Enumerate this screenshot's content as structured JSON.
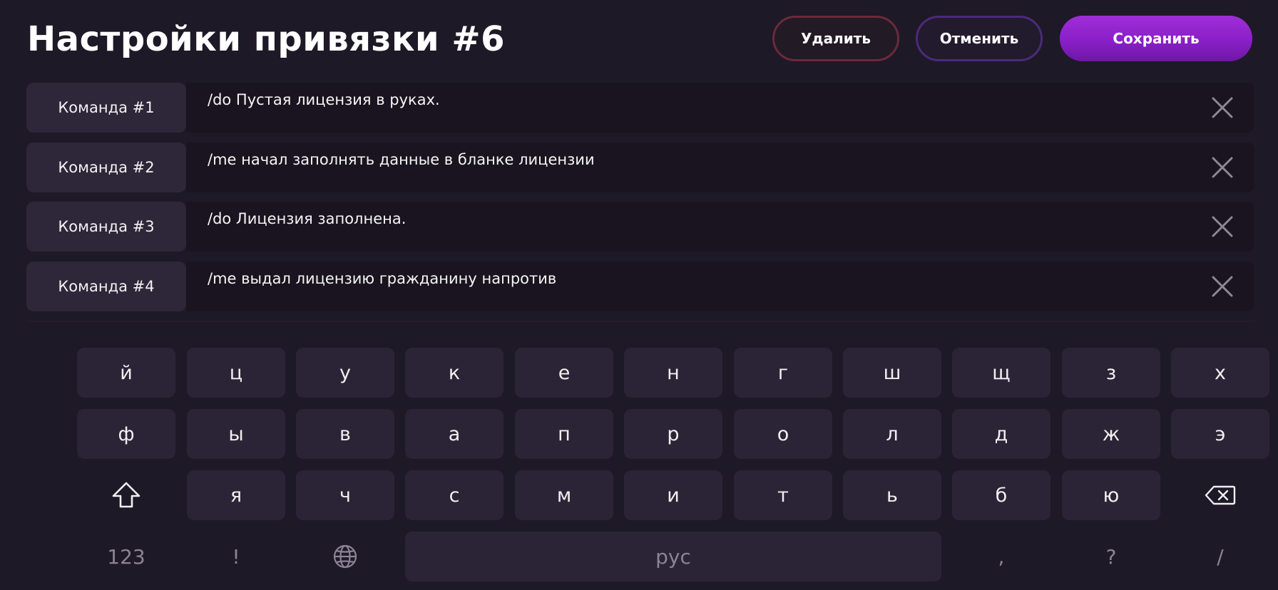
{
  "header": {
    "title": "Настройки привязки #6",
    "delete_label": "Удалить",
    "cancel_label": "Отменить",
    "save_label": "Сохранить"
  },
  "commands": [
    {
      "label": "Команда #1",
      "value": "/do Пустая лицензия в руках."
    },
    {
      "label": "Команда #2",
      "value": "/me начал заполнять данные в бланке лицензии"
    },
    {
      "label": "Команда #3",
      "value": "/do Лицензия заполнена."
    },
    {
      "label": "Команда #4",
      "value": "/me выдал лицензию гражданину напротив"
    }
  ],
  "keyboard": {
    "row1": [
      "й",
      "ц",
      "у",
      "к",
      "е",
      "н",
      "г",
      "ш",
      "щ",
      "з",
      "х"
    ],
    "row2": [
      "ф",
      "ы",
      "в",
      "а",
      "п",
      "р",
      "о",
      "л",
      "д",
      "ж",
      "э"
    ],
    "row3": [
      "я",
      "ч",
      "с",
      "м",
      "и",
      "т",
      "ь",
      "б",
      "ю"
    ],
    "numbers_label": "123",
    "exclamation": "!",
    "space_label": "рус",
    "comma": ",",
    "question": "?",
    "slash": "/",
    "shift_icon": "shift-icon",
    "backspace_icon": "backspace-icon",
    "globe_icon": "globe-icon"
  },
  "colors": {
    "background": "#1e1927",
    "accent": "#8a1fc8",
    "delete_border": "#6b2a3a",
    "cancel_border": "#4b2a7a"
  }
}
